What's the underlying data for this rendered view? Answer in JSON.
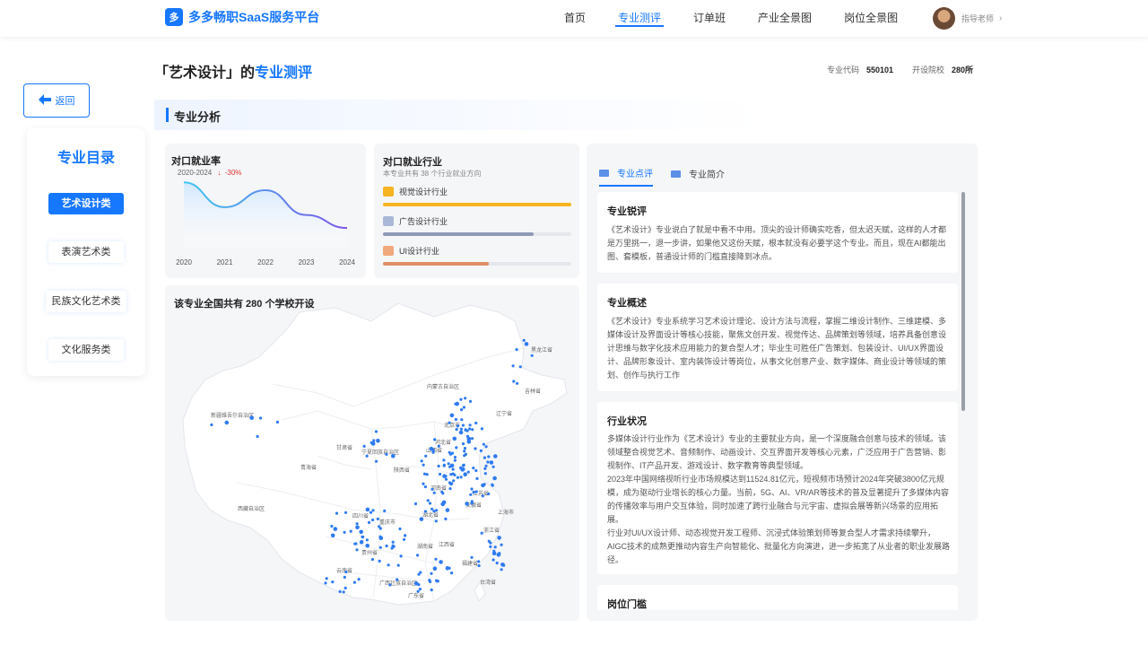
{
  "app": {
    "title": "多多畅职SaaS服务平台",
    "logo_mark": "多"
  },
  "nav": {
    "items": [
      {
        "label": "首页"
      },
      {
        "label": "专业测评",
        "active": true
      },
      {
        "label": "订单班"
      },
      {
        "label": "产业全景图"
      },
      {
        "label": "岗位全景图"
      }
    ]
  },
  "user": {
    "name": "指导老师",
    "chevron": "›"
  },
  "back": {
    "label": "返回",
    "icon": "arrow-left-icon"
  },
  "catalog": {
    "title": "专业目录",
    "items": [
      {
        "label": "艺术设计类",
        "active": true
      },
      {
        "label": "表演艺术类"
      },
      {
        "label": "民族文化艺术类"
      },
      {
        "label": "文化服务类"
      }
    ]
  },
  "page": {
    "title_prefix": "「艺术设计」的",
    "title_highlight": "专业测评",
    "code_label": "专业代码",
    "code_value": "550101",
    "schools_label": "开设院校",
    "schools_value": "280所"
  },
  "section": {
    "title": "专业分析"
  },
  "employment_rate": {
    "title": "对口就业率",
    "range": "2020-2024",
    "change_arrow": "↓",
    "change": "-30%"
  },
  "chart_data": {
    "type": "area",
    "title": "对口就业率",
    "categories": [
      "2020",
      "2021",
      "2022",
      "2023",
      "2024"
    ],
    "values": [
      100,
      62,
      88,
      50,
      30
    ],
    "ylim": [
      0,
      110
    ],
    "grid": false,
    "legend": "none",
    "colors": [
      "#3ec9f0",
      "#7b55e6"
    ]
  },
  "industries": {
    "title": "对口就业行业",
    "subtitle": "本专业共有 38 个行业就业方向",
    "items": [
      {
        "label": "视觉设计行业",
        "fraction": 1.0,
        "color": "#f6b422",
        "icon": "gold-medal-icon"
      },
      {
        "label": "广告设计行业",
        "fraction": 0.8,
        "color": "#8e9ab6",
        "icon": "silver-medal-icon"
      },
      {
        "label": "UI设计行业",
        "fraction": 0.56,
        "color": "#e08e66",
        "icon": "bronze-medal-icon"
      }
    ]
  },
  "map": {
    "title": "该专业全国共有 280 个学校开设",
    "regions": [
      "黑龙江省",
      "吉林省",
      "辽宁省",
      "内蒙古自治区",
      "新疆维吾尔自治区",
      "北京市",
      "河北省",
      "山西省",
      "甘肃省",
      "宁夏回族自治区",
      "陕西省",
      "青海省",
      "河南省",
      "江苏省",
      "四川省",
      "重庆市",
      "湖北省",
      "安徽省",
      "上海市",
      "西藏自治区",
      "湖南省",
      "江西省",
      "浙江省",
      "贵州省",
      "云南省",
      "广西壮族自治区",
      "广东省",
      "福建省",
      "台湾省"
    ]
  },
  "tabs": [
    {
      "label": "专业点评",
      "active": true
    },
    {
      "label": "专业简介"
    }
  ],
  "blocks": [
    {
      "title": "专业锐评",
      "text": "《艺术设计》专业说白了就是中看不中用。顶尖的设计师确实吃香，但太迟天赋，这样的人才都是万里挑一，退一步讲，如果他又这份天赋，根本就没有必要学这个专业。而且，现在AI都能出图、套模板，普通设计师的门槛直接降到冰点。"
    },
    {
      "title": "专业概述",
      "text": "《艺术设计》专业系统学习艺术设计理论、设计方法与流程，掌握二维设计制作、三维建模、多媒体设计及界面设计等核心技能，聚焦文创开发、视觉传达、品牌策划等领域，培养具备创意设计思维与数字化技术应用能力的复合型人才；毕业生可胜任广告策划、包装设计、UI/UX界面设计、品牌形象设计、室内装饰设计等岗位，从事文化创意产业、数字媒体、商业设计等领域的策划、创作与执行工作"
    },
    {
      "title": "行业状况",
      "text": "多媒体设计行业作为《艺术设计》专业的主要就业方向，是一个深度融合创意与技术的领域。该领域整合视觉艺术、音频制作、动画设计、交互界面开发等核心元素，广泛应用于广告营销、影视制作、IT产品开发、游戏设计、数字教育等典型领域。\n2023年中国网络视听行业市场规模达到11524.81亿元，短视频市场预计2024年突破3800亿元规模，成为驱动行业增长的核心力量。当前，5G、AI、VR/AR等技术的普及显著提升了多媒体内容的传播效率与用户交互体验，同时加速了跨行业融合与元宇宙、虚拟会展等新兴场景的应用拓展。\n行业对UI/UX设计师、动态视觉开发工程师、沉浸式体验策划师等复合型人才需求持续攀升，AIGC技术的成熟更推动内容生产向智能化、批量化方向演进，进一步拓宽了从业者的职业发展路径。"
    },
    {
      "title": "岗位门槛",
      "text": ""
    }
  ]
}
